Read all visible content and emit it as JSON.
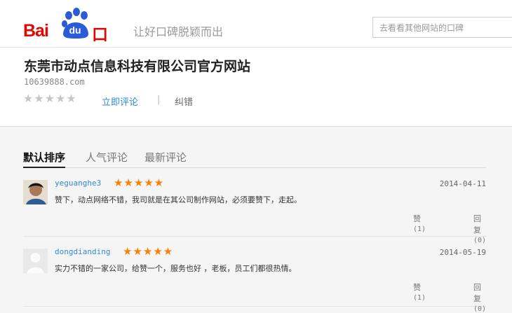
{
  "header": {
    "logo_left": "Bai",
    "logo_middle": "du",
    "logo_right": "口碑",
    "slogan": "让好口碑脱颖而出",
    "search_placeholder": "去看看其他网站的口碑"
  },
  "site": {
    "title": "东莞市动点信息科技有限公司官方网站",
    "url": "10639888.com",
    "rating": "★★★★★",
    "rating_value": 0,
    "review_link": "立即评论",
    "separator": "|",
    "correction_link": "纠错"
  },
  "tabs": [
    "默认排序",
    "人气评论",
    "最新评论"
  ],
  "reviews": [
    {
      "user": "yeguanghe3",
      "stars": "★★★★★",
      "date": "2014-04-11",
      "content": "赞下，动点网络不错，我司就是在其公司制作网站，必须要赞下，走起。",
      "like_label": "赞",
      "like_count": "(1)",
      "reply_label": "回复",
      "reply_count": "(0)"
    },
    {
      "user": "dongdianding",
      "stars": "★★★★★",
      "date": "2014-05-19",
      "content": "实力不错的一家公司，给赞一个，服务也好 ，老板，员工们都很热情。",
      "like_label": "赞",
      "like_count": "(1)",
      "reply_label": "回复",
      "reply_count": "(0)"
    }
  ],
  "colors": {
    "brand_red": "#e10601",
    "link_blue": "#2f8bd3",
    "star_orange": "#ff7f00"
  }
}
